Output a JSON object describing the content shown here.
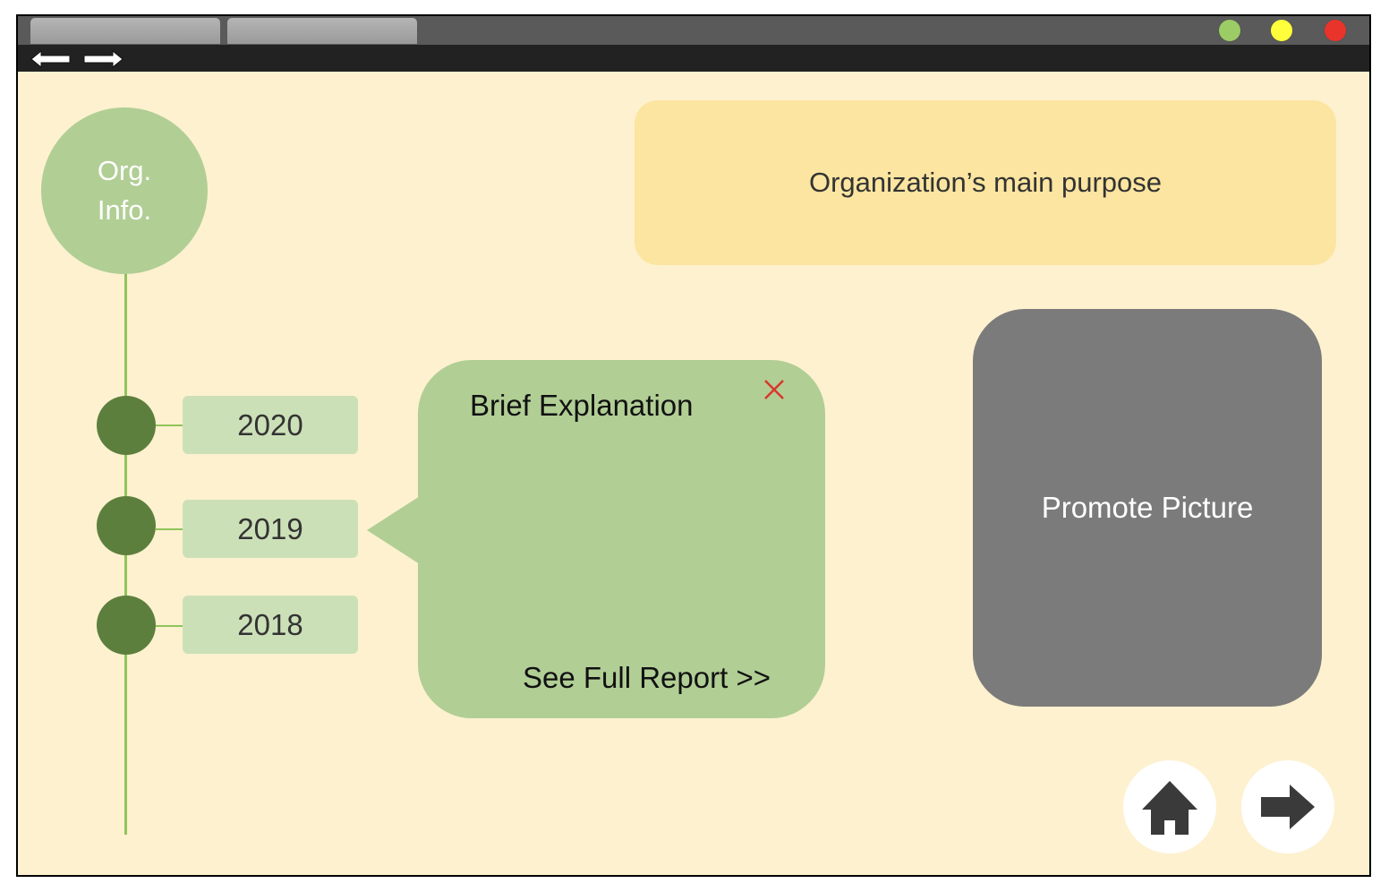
{
  "window": {
    "tabs": [
      "",
      ""
    ],
    "controls": [
      {
        "name": "minimize",
        "color": "#9ccc65"
      },
      {
        "name": "maximize",
        "color": "#ffff3b"
      },
      {
        "name": "close",
        "color": "#e8342a"
      }
    ],
    "nav": {
      "back_icon": "arrow-left-icon",
      "forward_icon": "arrow-right-icon"
    }
  },
  "timeline": {
    "header": "Org.\nInfo.",
    "years": [
      "2020",
      "2019",
      "2018"
    ],
    "selected_year": "2019"
  },
  "purpose": {
    "text": "Organization’s main purpose"
  },
  "explanation": {
    "title": "Brief Explanation",
    "close_icon": "close-icon",
    "link": "See Full Report >>"
  },
  "promo": {
    "label": "Promote Picture"
  },
  "bottom_nav": {
    "home_icon": "home-icon",
    "next_icon": "arrow-right-icon"
  },
  "colors": {
    "background": "#fdf1cf",
    "timeline_green": "#5d7f3d",
    "light_green": "#b1ce95",
    "year_box": "#cce0b8",
    "purpose_box": "#fbe5a0",
    "promo_box": "#7b7b7b",
    "close_red": "#d9362b"
  }
}
